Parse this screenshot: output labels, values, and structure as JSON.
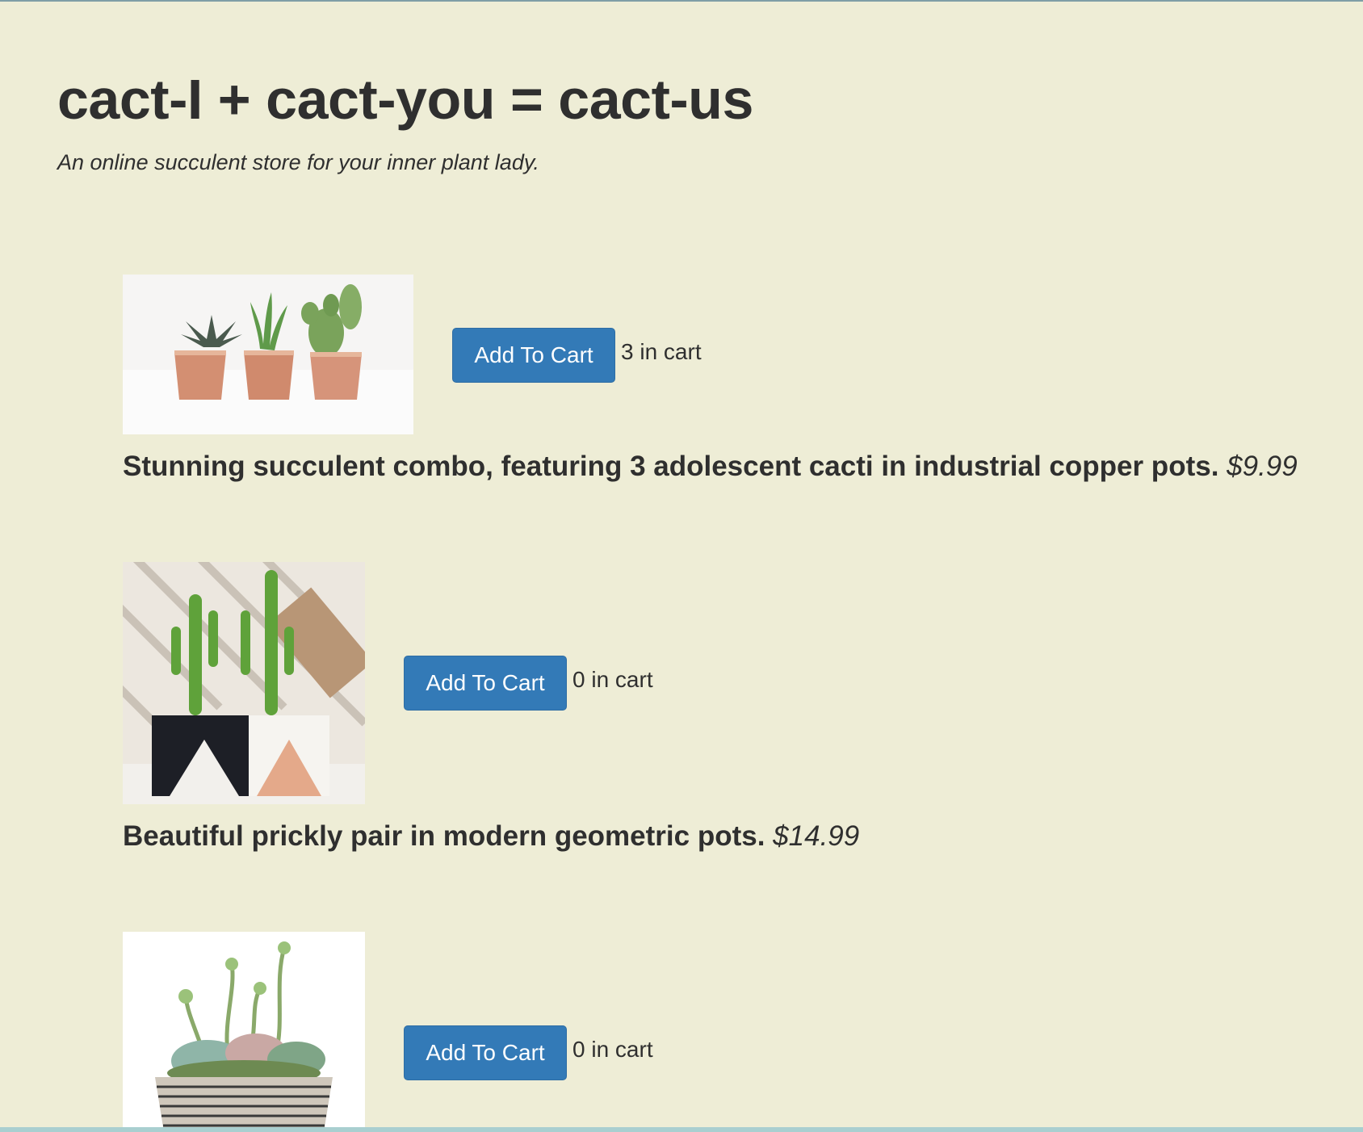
{
  "header": {
    "title": "cact-I + cact-you = cact-us",
    "tagline": "An online succulent store for your inner plant lady."
  },
  "products": [
    {
      "image_alt": "three small cacti in copper pots",
      "button_label": "Add To Cart",
      "cart_count_text": "3 in cart",
      "description": "Stunning succulent combo, featuring 3 adolescent cacti in industrial copper pots.",
      "price": "$9.99"
    },
    {
      "image_alt": "two cacti in black and white geometric pots",
      "button_label": "Add To Cart",
      "cart_count_text": "0 in cart",
      "description": "Beautiful prickly pair in modern geometric pots.",
      "price": "$14.99"
    },
    {
      "image_alt": "succulent arrangement in striped round planter",
      "button_label": "Add To Cart",
      "cart_count_text": "0 in cart",
      "description": "",
      "price": ""
    }
  ],
  "colors": {
    "page_background": "#eeedd6",
    "button_primary": "#337ab7",
    "text": "#2f2f2f"
  }
}
